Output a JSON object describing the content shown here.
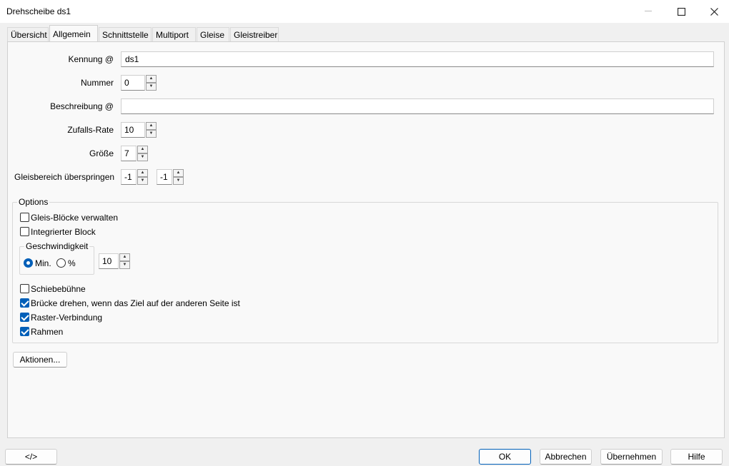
{
  "window": {
    "title": "Drehscheibe ds1"
  },
  "tabs": [
    {
      "label": "Übersicht"
    },
    {
      "label": "Allgemein"
    },
    {
      "label": "Schnittstelle"
    },
    {
      "label": "Multiport"
    },
    {
      "label": "Gleise"
    },
    {
      "label": "Gleistreiber"
    }
  ],
  "form": {
    "kennung": {
      "label": "Kennung @",
      "value": "ds1"
    },
    "nummer": {
      "label": "Nummer",
      "value": "0"
    },
    "beschreibung": {
      "label": "Beschreibung @",
      "value": ""
    },
    "zufallsrate": {
      "label": "Zufalls-Rate",
      "value": "10"
    },
    "groesse": {
      "label": "Größe",
      "value": "7"
    },
    "gleisbereich": {
      "label": "Gleisbereich überspringen",
      "from": "-1",
      "to": "-1"
    }
  },
  "options": {
    "title": "Options",
    "gleis_bloecke": {
      "label": "Gleis-Blöcke verwalten",
      "checked": false
    },
    "integrierter_block": {
      "label": "Integrierter Block",
      "checked": false
    },
    "geschwindigkeit": {
      "title": "Geschwindigkeit",
      "min_label": "Min.",
      "percent_label": "%",
      "selected": "Min.",
      "value": "10"
    },
    "schiebebuehne": {
      "label": "Schiebebühne",
      "checked": false
    },
    "bruecke_drehen": {
      "label": "Brücke drehen, wenn das Ziel auf der anderen Seite ist",
      "checked": true
    },
    "raster_verbindung": {
      "label": "Raster-Verbindung",
      "checked": true
    },
    "rahmen": {
      "label": "Rahmen",
      "checked": true
    }
  },
  "buttons": {
    "aktionen": "Aktionen...",
    "code": "</>",
    "ok": "OK",
    "abbrechen": "Abbrechen",
    "uebernehmen": "Übernehmen",
    "hilfe": "Hilfe"
  }
}
